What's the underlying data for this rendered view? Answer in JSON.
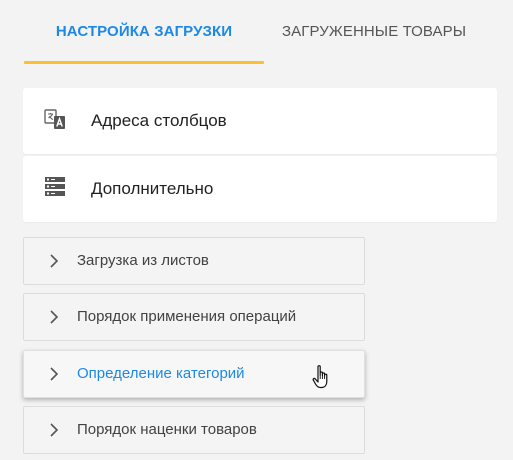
{
  "tabs": [
    {
      "label": "НАСТРОЙКА ЗАГРУЗКИ",
      "active": true
    },
    {
      "label": "ЗАГРУЖЕННЫЕ ТОВАРЫ",
      "active": false
    }
  ],
  "accent_color": "#1e88e5",
  "underline_color": "#fbc02d",
  "cards": [
    {
      "label": "Адреса столбцов",
      "icon": "translate-icon"
    },
    {
      "label": "Дополнительно",
      "icon": "storage-icon"
    }
  ],
  "panels": [
    {
      "label": "Загрузка из листов",
      "expanded": false
    },
    {
      "label": "Порядок применения операций",
      "expanded": false
    },
    {
      "label": "Определение категорий",
      "expanded": false,
      "hovered": true
    },
    {
      "label": "Порядок наценки товаров",
      "expanded": false
    }
  ]
}
